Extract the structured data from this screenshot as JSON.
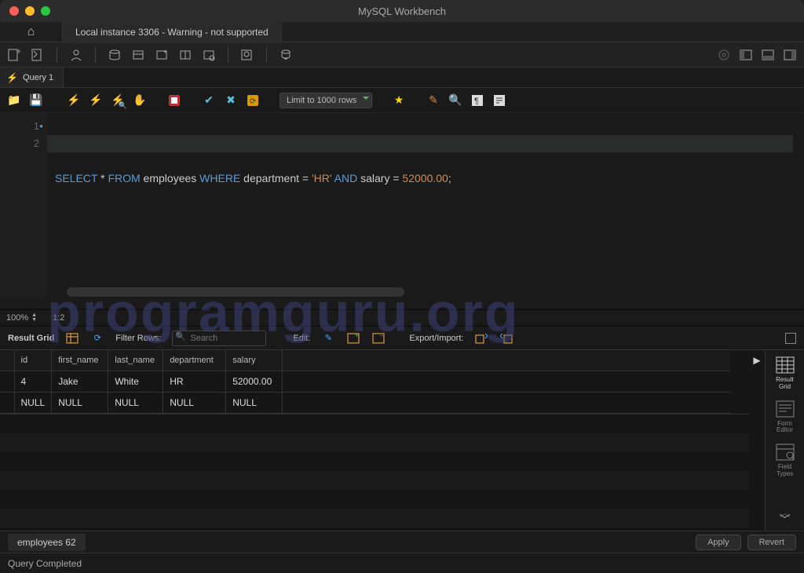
{
  "window": {
    "title": "MySQL Workbench"
  },
  "connection_tab": "Local instance 3306 - Warning - not supported",
  "query_tab": "Query 1",
  "limit_dropdown": "Limit to 1000 rows",
  "sql": {
    "line1": {
      "t1": "SELECT",
      "t2": " * ",
      "t3": "FROM",
      "t4": " employees ",
      "t5": "WHERE",
      "t6": " department = ",
      "t7": "'HR'",
      "t8": " ",
      "t9": "AND",
      "t10": " salary = ",
      "t11": "52000.00",
      "t12": ";"
    }
  },
  "gutter": [
    "1",
    "2"
  ],
  "zoom": "100%",
  "cursor_pos": "1:2",
  "results": {
    "label": "Result Grid",
    "filter_label": "Filter Rows:",
    "search_placeholder": "Search",
    "edit_label": "Edit:",
    "export_label": "Export/Import:",
    "columns": [
      "",
      "id",
      "first_name",
      "last_name",
      "department",
      "salary"
    ],
    "rows": [
      [
        "",
        "4",
        "Jake",
        "White",
        "HR",
        "52000.00"
      ]
    ],
    "null_row": [
      "",
      "NULL",
      "NULL",
      "NULL",
      "NULL",
      "NULL"
    ],
    "tab_name": "employees 62"
  },
  "side_panel": {
    "result_grid": "Result\nGrid",
    "form_editor": "Form\nEditor",
    "field_types": "Field\nTypes"
  },
  "buttons": {
    "apply": "Apply",
    "revert": "Revert"
  },
  "status": "Query Completed",
  "watermark": "programguru.org"
}
